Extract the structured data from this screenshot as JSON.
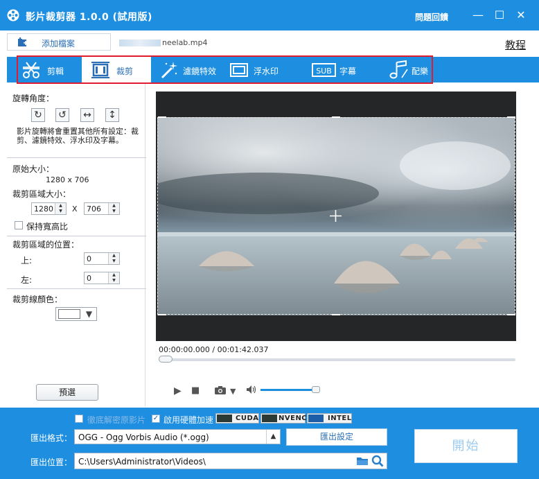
{
  "window": {
    "title": "影片裁剪器 1.0.0 (試用版)",
    "feedback": "問題回饋",
    "minimize": "—",
    "maximize": "☐",
    "close": "✕"
  },
  "toolbar": {
    "add_file": "添加檔案",
    "filename_suffix": "neelab.mp4",
    "tutorial": "教程"
  },
  "tabs": [
    {
      "label": "剪輯",
      "icon": "scissors-icon"
    },
    {
      "label": "裁剪",
      "icon": "crop-icon",
      "active": true
    },
    {
      "label": "濾鏡特效",
      "icon": "magic-wand-icon"
    },
    {
      "label": "浮水印",
      "icon": "watermark-icon"
    },
    {
      "label": "字幕",
      "icon": "subtitle-icon"
    },
    {
      "label": "配樂",
      "icon": "music-icon"
    }
  ],
  "crop_panel": {
    "rotation_title": "旋轉角度：",
    "rotation_buttons": [
      "rotate-clockwise",
      "rotate-counterclockwise",
      "flip-horizontal",
      "flip-vertical"
    ],
    "rotation_note": "影片旋轉將會重置其他所有設定：裁剪、濾鏡特效、浮水印及字幕。",
    "original_size_title": "原始大小：",
    "original_size": "1280 x 706",
    "crop_area_size_title": "裁剪區域大小：",
    "crop_width": "1280",
    "size_separator": "X",
    "crop_height": "706",
    "keep_aspect": "保持寬高比",
    "crop_position_title": "裁剪區域的位置：",
    "top_label": "上:",
    "top_value": "0",
    "left_label": "左:",
    "left_value": "0",
    "crop_line_color_title": "裁剪線顏色：",
    "crop_line_color": "#ffffff",
    "preset_button": "預選"
  },
  "player": {
    "timecode": "00:00:00.000 / 00:01:42.037",
    "play_progress": 0.0,
    "volume": 0.95
  },
  "bottom": {
    "decode_label": "徹底解密原影片",
    "decode_checked": false,
    "hw_accel_label": "啟用硬體加速",
    "hw_accel_checked": true,
    "accel_badges": [
      "CUDA",
      "NVENC",
      "INTEL"
    ],
    "format_label": "匯出格式：",
    "format_value": "OGG - Ogg Vorbis Audio (*.ogg)",
    "export_settings": "匯出設定",
    "location_label": "匯出位置：",
    "location_value": "C:\\Users\\Administrator\\Videos\\",
    "start_button": "開始"
  },
  "colors": {
    "brand_blue": "#1e8fe0",
    "highlight_red": "#e01b2d",
    "start_text": "#9ccbf1"
  }
}
